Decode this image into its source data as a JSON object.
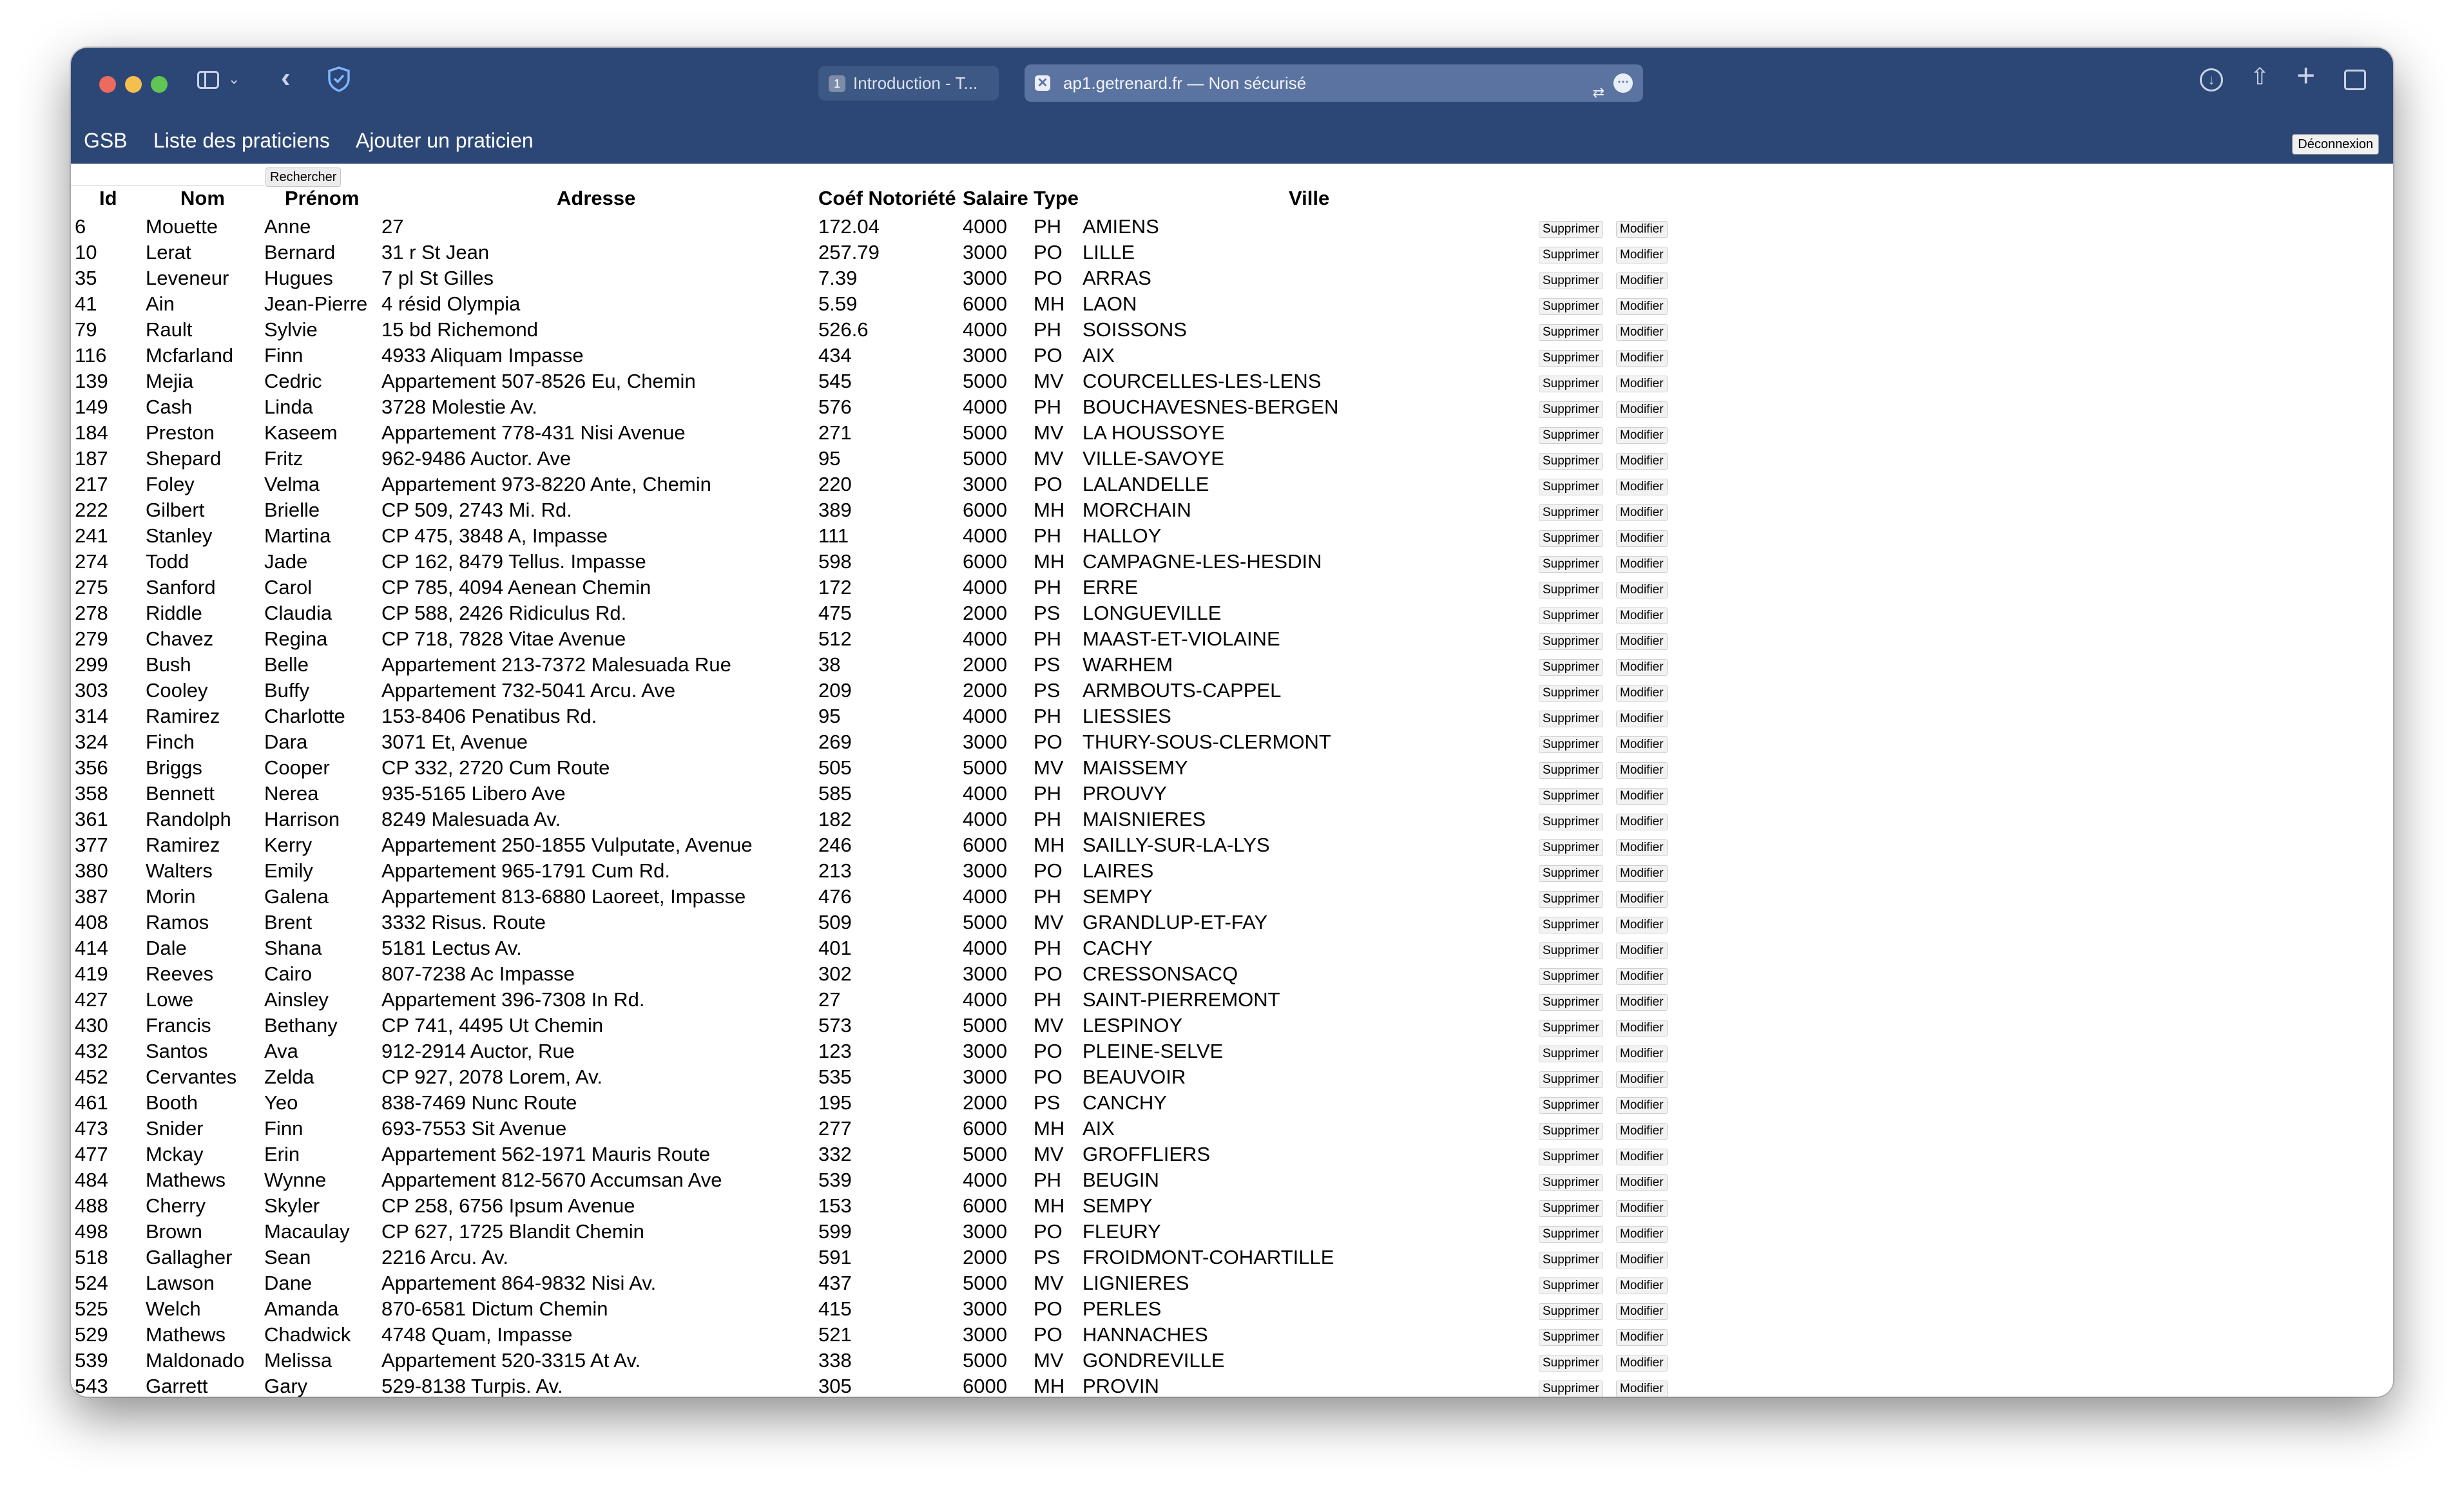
{
  "browser": {
    "tab1": {
      "badge": "1",
      "label": "Introduction - T..."
    },
    "tab2": {
      "close": "✕",
      "label": "ap1.getrenard.fr — Non sécurisé"
    }
  },
  "nav": {
    "brand": "GSB",
    "list": "Liste des praticiens",
    "add": "Ajouter un praticien",
    "logout": "Déconnexion"
  },
  "search": {
    "button": "Rechercher"
  },
  "table": {
    "headers": {
      "id": "Id",
      "nom": "Nom",
      "prenom": "Prénom",
      "adresse": "Adresse",
      "coef": "Coéf Notoriété",
      "salaire": "Salaire",
      "type": "Type",
      "ville": "Ville"
    },
    "actions": {
      "delete": "Supprimer",
      "edit": "Modifier"
    },
    "rows": [
      [
        "6",
        "Mouette",
        "Anne",
        "27",
        "172.04",
        "4000",
        "PH",
        "AMIENS"
      ],
      [
        "10",
        "Lerat",
        "Bernard",
        "31 r St Jean",
        "257.79",
        "3000",
        "PO",
        "LILLE"
      ],
      [
        "35",
        "Leveneur",
        "Hugues",
        "7 pl St Gilles",
        "7.39",
        "3000",
        "PO",
        "ARRAS"
      ],
      [
        "41",
        "Ain",
        "Jean-Pierre",
        "4 résid Olympia",
        "5.59",
        "6000",
        "MH",
        "LAON"
      ],
      [
        "79",
        "Rault",
        "Sylvie",
        "15 bd Richemond",
        "526.6",
        "4000",
        "PH",
        "SOISSONS"
      ],
      [
        "116",
        "Mcfarland",
        "Finn",
        "4933 Aliquam Impasse",
        "434",
        "3000",
        "PO",
        "AIX"
      ],
      [
        "139",
        "Mejia",
        "Cedric",
        "Appartement 507-8526 Eu, Chemin",
        "545",
        "5000",
        "MV",
        "COURCELLES-LES-LENS"
      ],
      [
        "149",
        "Cash",
        "Linda",
        "3728 Molestie Av.",
        "576",
        "4000",
        "PH",
        "BOUCHAVESNES-BERGEN"
      ],
      [
        "184",
        "Preston",
        "Kaseem",
        "Appartement 778-431 Nisi Avenue",
        "271",
        "5000",
        "MV",
        "LA HOUSSOYE"
      ],
      [
        "187",
        "Shepard",
        "Fritz",
        "962-9486 Auctor. Ave",
        "95",
        "5000",
        "MV",
        "VILLE-SAVOYE"
      ],
      [
        "217",
        "Foley",
        "Velma",
        "Appartement 973-8220 Ante, Chemin",
        "220",
        "3000",
        "PO",
        "LALANDELLE"
      ],
      [
        "222",
        "Gilbert",
        "Brielle",
        "CP 509, 2743 Mi. Rd.",
        "389",
        "6000",
        "MH",
        "MORCHAIN"
      ],
      [
        "241",
        "Stanley",
        "Martina",
        "CP 475, 3848 A, Impasse",
        "111",
        "4000",
        "PH",
        "HALLOY"
      ],
      [
        "274",
        "Todd",
        "Jade",
        "CP 162, 8479 Tellus. Impasse",
        "598",
        "6000",
        "MH",
        "CAMPAGNE-LES-HESDIN"
      ],
      [
        "275",
        "Sanford",
        "Carol",
        "CP 785, 4094 Aenean Chemin",
        "172",
        "4000",
        "PH",
        "ERRE"
      ],
      [
        "278",
        "Riddle",
        "Claudia",
        "CP 588, 2426 Ridiculus Rd.",
        "475",
        "2000",
        "PS",
        "LONGUEVILLE"
      ],
      [
        "279",
        "Chavez",
        "Regina",
        "CP 718, 7828 Vitae Avenue",
        "512",
        "4000",
        "PH",
        "MAAST-ET-VIOLAINE"
      ],
      [
        "299",
        "Bush",
        "Belle",
        "Appartement 213-7372 Malesuada Rue",
        "38",
        "2000",
        "PS",
        "WARHEM"
      ],
      [
        "303",
        "Cooley",
        "Buffy",
        "Appartement 732-5041 Arcu. Ave",
        "209",
        "2000",
        "PS",
        "ARMBOUTS-CAPPEL"
      ],
      [
        "314",
        "Ramirez",
        "Charlotte",
        "153-8406 Penatibus Rd.",
        "95",
        "4000",
        "PH",
        "LIESSIES"
      ],
      [
        "324",
        "Finch",
        "Dara",
        "3071 Et, Avenue",
        "269",
        "3000",
        "PO",
        "THURY-SOUS-CLERMONT"
      ],
      [
        "356",
        "Briggs",
        "Cooper",
        "CP 332, 2720 Cum Route",
        "505",
        "5000",
        "MV",
        "MAISSEMY"
      ],
      [
        "358",
        "Bennett",
        "Nerea",
        "935-5165 Libero Ave",
        "585",
        "4000",
        "PH",
        "PROUVY"
      ],
      [
        "361",
        "Randolph",
        "Harrison",
        "8249 Malesuada Av.",
        "182",
        "4000",
        "PH",
        "MAISNIERES"
      ],
      [
        "377",
        "Ramirez",
        "Kerry",
        "Appartement 250-1855 Vulputate, Avenue",
        "246",
        "6000",
        "MH",
        "SAILLY-SUR-LA-LYS"
      ],
      [
        "380",
        "Walters",
        "Emily",
        "Appartement 965-1791 Cum Rd.",
        "213",
        "3000",
        "PO",
        "LAIRES"
      ],
      [
        "387",
        "Morin",
        "Galena",
        "Appartement 813-6880 Laoreet, Impasse",
        "476",
        "4000",
        "PH",
        "SEMPY"
      ],
      [
        "408",
        "Ramos",
        "Brent",
        "3332 Risus. Route",
        "509",
        "5000",
        "MV",
        "GRANDLUP-ET-FAY"
      ],
      [
        "414",
        "Dale",
        "Shana",
        "5181 Lectus Av.",
        "401",
        "4000",
        "PH",
        "CACHY"
      ],
      [
        "419",
        "Reeves",
        "Cairo",
        "807-7238 Ac Impasse",
        "302",
        "3000",
        "PO",
        "CRESSONSACQ"
      ],
      [
        "427",
        "Lowe",
        "Ainsley",
        "Appartement 396-7308 In Rd.",
        "27",
        "4000",
        "PH",
        "SAINT-PIERREMONT"
      ],
      [
        "430",
        "Francis",
        "Bethany",
        "CP 741, 4495 Ut Chemin",
        "573",
        "5000",
        "MV",
        "LESPINOY"
      ],
      [
        "432",
        "Santos",
        "Ava",
        "912-2914 Auctor, Rue",
        "123",
        "3000",
        "PO",
        "PLEINE-SELVE"
      ],
      [
        "452",
        "Cervantes",
        "Zelda",
        "CP 927, 2078 Lorem, Av.",
        "535",
        "3000",
        "PO",
        "BEAUVOIR"
      ],
      [
        "461",
        "Booth",
        "Yeo",
        "838-7469 Nunc Route",
        "195",
        "2000",
        "PS",
        "CANCHY"
      ],
      [
        "473",
        "Snider",
        "Finn",
        "693-7553 Sit Avenue",
        "277",
        "6000",
        "MH",
        "AIX"
      ],
      [
        "477",
        "Mckay",
        "Erin",
        "Appartement 562-1971 Mauris Route",
        "332",
        "5000",
        "MV",
        "GROFFLIERS"
      ],
      [
        "484",
        "Mathews",
        "Wynne",
        "Appartement 812-5670 Accumsan Ave",
        "539",
        "4000",
        "PH",
        "BEUGIN"
      ],
      [
        "488",
        "Cherry",
        "Skyler",
        "CP 258, 6756 Ipsum Avenue",
        "153",
        "6000",
        "MH",
        "SEMPY"
      ],
      [
        "498",
        "Brown",
        "Macaulay",
        "CP 627, 1725 Blandit Chemin",
        "599",
        "3000",
        "PO",
        "FLEURY"
      ],
      [
        "518",
        "Gallagher",
        "Sean",
        "2216 Arcu. Av.",
        "591",
        "2000",
        "PS",
        "FROIDMONT-COHARTILLE"
      ],
      [
        "524",
        "Lawson",
        "Dane",
        "Appartement 864-9832 Nisi Av.",
        "437",
        "5000",
        "MV",
        "LIGNIERES"
      ],
      [
        "525",
        "Welch",
        "Amanda",
        "870-6581 Dictum Chemin",
        "415",
        "3000",
        "PO",
        "PERLES"
      ],
      [
        "529",
        "Mathews",
        "Chadwick",
        "4748 Quam, Impasse",
        "521",
        "3000",
        "PO",
        "HANNACHES"
      ],
      [
        "539",
        "Maldonado",
        "Melissa",
        "Appartement 520-3315 At Av.",
        "338",
        "5000",
        "MV",
        "GONDREVILLE"
      ],
      [
        "543",
        "Garrett",
        "Gary",
        "529-8138 Turpis. Av.",
        "305",
        "6000",
        "MH",
        "PROVIN"
      ]
    ]
  }
}
